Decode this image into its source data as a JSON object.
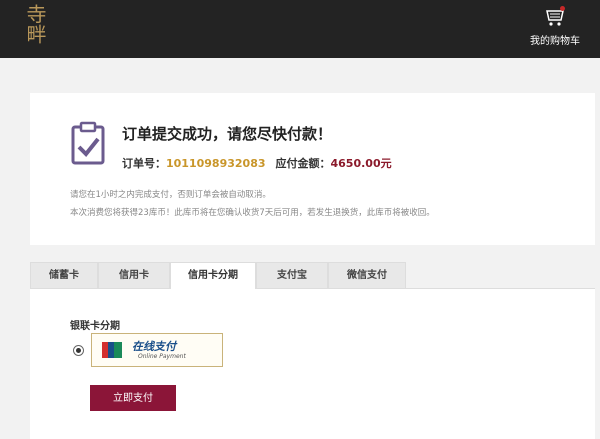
{
  "header": {
    "logo_text": "寺畔",
    "cart_label": "我的购物车"
  },
  "order": {
    "headline": "订单提交成功，请您尽快付款！",
    "order_no_label": "订单号：",
    "order_no": "1011098932083",
    "amount_label": "应付金额：",
    "amount": "4650.00元",
    "note1": "请您在1小时之内完成支付，否则订单会被自动取消。",
    "note2": "本次消费您将获得23库币！此库币将在您确认收货7天后可用，若发生退换货，此库币将被收回。"
  },
  "tabs": [
    {
      "label": "储蓄卡"
    },
    {
      "label": "信用卡"
    },
    {
      "label": "信用卡分期"
    },
    {
      "label": "支付宝"
    },
    {
      "label": "微信支付"
    }
  ],
  "installment": {
    "title": "银联卡分期",
    "bank_cn": "在线支付",
    "bank_en": "Online Payment",
    "pay_button": "立即支付"
  },
  "colors": {
    "topbar": "#232323",
    "accent": "#8b1538",
    "order_no": "#c9962a",
    "amount": "#8b1a2b"
  }
}
